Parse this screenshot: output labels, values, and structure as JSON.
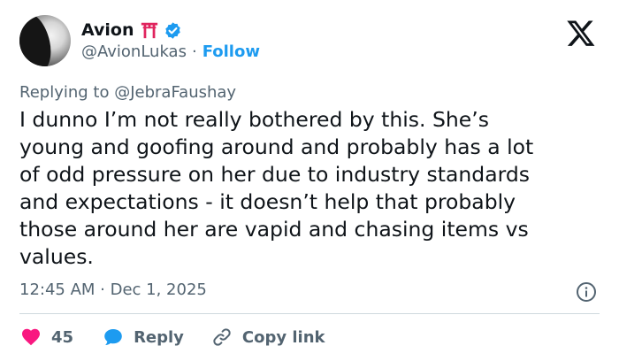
{
  "author": {
    "display_name": "Avion",
    "handle": "@AvionLukas",
    "separator": "·",
    "follow_label": "Follow"
  },
  "reply_context": {
    "prefix": "Replying to",
    "handle": "@JebraFaushay"
  },
  "tweet": {
    "lines": [
      "I dunno I’m not really bothered by this. She’s",
      "young and goofing around and probably has a lot",
      "of odd pressure on her due to industry standards",
      "and expectations - it doesn’t help that probably",
      "those around her are vapid and chasing items vs",
      "values."
    ],
    "timestamp": "12:45 AM · Dec 1, 2025"
  },
  "actions": {
    "like_count": "45",
    "reply_label": "Reply",
    "copy_label": "Copy link"
  },
  "colors": {
    "accent": "#1d9bf0",
    "like": "#f91880",
    "muted": "#536471",
    "torii": "#e0245e"
  },
  "icons": {
    "emoji": "torii-gate-icon",
    "verified": "verified-badge-icon",
    "logo": "x-logo-icon",
    "info": "info-icon",
    "like": "heart-icon",
    "reply": "speech-bubble-icon",
    "copy": "link-icon"
  }
}
